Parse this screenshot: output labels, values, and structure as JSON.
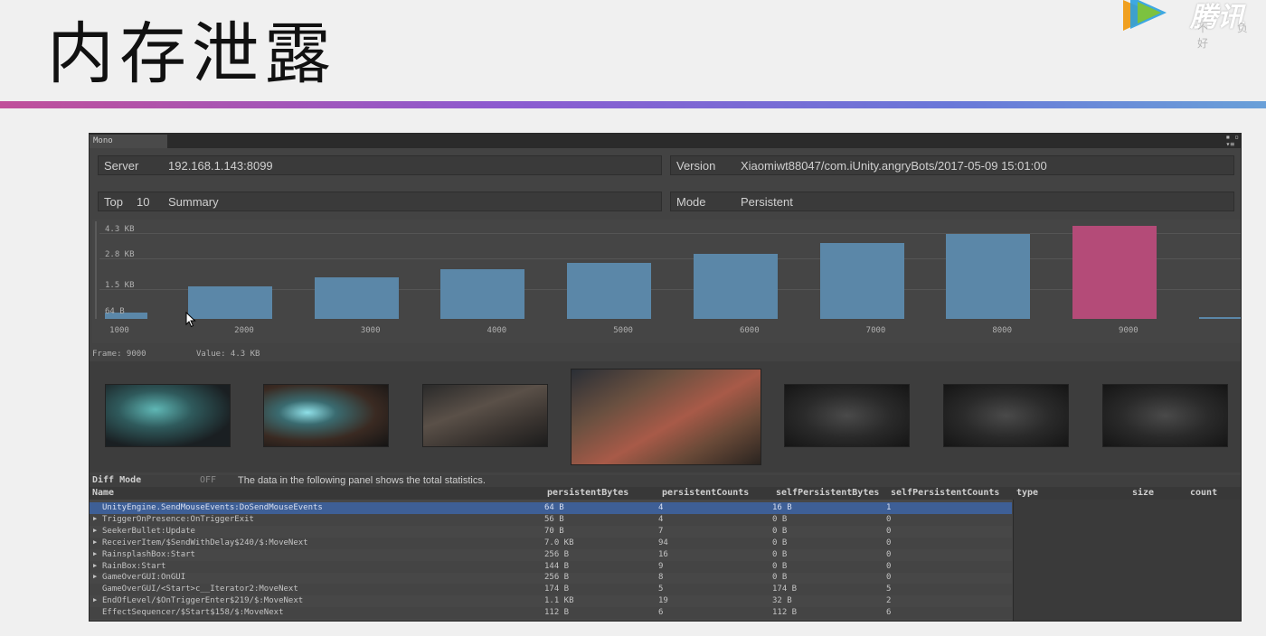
{
  "slide": {
    "title": "内存泄露"
  },
  "logo": {
    "text": "腾讯",
    "sub": "不 负 好"
  },
  "panel": {
    "tab": "Mono",
    "server_label": "Server",
    "server_value": "192.168.1.143:8099",
    "version_label": "Version",
    "version_value": "Xiaomiwt88047/com.iUnity.angryBots/2017-05-09 15:01:00",
    "top_label": "Top",
    "top_value": "10",
    "summary_label": "Summary",
    "mode_label": "Mode",
    "mode_value": "Persistent"
  },
  "chart_data": {
    "type": "bar",
    "yticks": [
      "4.3 KB",
      "2.8 KB",
      "1.5 KB",
      "64 B"
    ],
    "xticks": [
      "1000",
      "2000",
      "3000",
      "4000",
      "5000",
      "6000",
      "7000",
      "8000",
      "9000"
    ],
    "bars": [
      {
        "frame": 1000,
        "value_kb": 0.3,
        "highlight": false
      },
      {
        "frame": 2000,
        "value_kb": 1.5,
        "highlight": false
      },
      {
        "frame": 3000,
        "value_kb": 1.9,
        "highlight": false
      },
      {
        "frame": 4000,
        "value_kb": 2.3,
        "highlight": false
      },
      {
        "frame": 5000,
        "value_kb": 2.6,
        "highlight": false
      },
      {
        "frame": 6000,
        "value_kb": 3.0,
        "highlight": false
      },
      {
        "frame": 7000,
        "value_kb": 3.5,
        "highlight": false
      },
      {
        "frame": 8000,
        "value_kb": 3.9,
        "highlight": false
      },
      {
        "frame": 9000,
        "value_kb": 4.3,
        "highlight": true
      },
      {
        "frame": 10000,
        "value_kb": 0.02,
        "highlight": false
      }
    ],
    "colors": {
      "bar": "#5b87a8",
      "highlight": "#b44b78"
    }
  },
  "frame_info": {
    "frame": "Frame: 9000",
    "value": "Value: 4.3 KB"
  },
  "diff": {
    "label": "Diff Mode",
    "state": "OFF",
    "note": "The data in the following panel shows the total statistics."
  },
  "table": {
    "headers": [
      "Name",
      "persistentBytes",
      "persistentCounts",
      "selfPersistentBytes",
      "selfPersistentCounts"
    ],
    "side_headers": [
      "type",
      "size",
      "count"
    ],
    "rows": [
      {
        "name": "UnityEngine.SendMouseEvents:DoSendMouseEvents",
        "pb": "64 B",
        "pc": "4",
        "spb": "16 B",
        "spc": "1",
        "expand": ""
      },
      {
        "name": "TriggerOnPresence:OnTriggerExit",
        "pb": "56 B",
        "pc": "4",
        "spb": "0 B",
        "spc": "0",
        "expand": "▶"
      },
      {
        "name": "SeekerBullet:Update",
        "pb": "70 B",
        "pc": "7",
        "spb": "0 B",
        "spc": "0",
        "expand": "▶"
      },
      {
        "name": "ReceiverItem/$SendWithDelay$240/$:MoveNext",
        "pb": "7.0 KB",
        "pc": "94",
        "spb": "0 B",
        "spc": "0",
        "expand": "▶"
      },
      {
        "name": "RainsplashBox:Start",
        "pb": "256 B",
        "pc": "16",
        "spb": "0 B",
        "spc": "0",
        "expand": "▶"
      },
      {
        "name": "RainBox:Start",
        "pb": "144 B",
        "pc": "9",
        "spb": "0 B",
        "spc": "0",
        "expand": "▶"
      },
      {
        "name": "GameOverGUI:OnGUI",
        "pb": "256 B",
        "pc": "8",
        "spb": "0 B",
        "spc": "0",
        "expand": "▶"
      },
      {
        "name": "GameOverGUI/<Start>c__Iterator2:MoveNext",
        "pb": "174 B",
        "pc": "5",
        "spb": "174 B",
        "spc": "5",
        "expand": ""
      },
      {
        "name": "EndOfLevel/$OnTriggerEnter$219/$:MoveNext",
        "pb": "1.1 KB",
        "pc": "19",
        "spb": "32 B",
        "spc": "2",
        "expand": "▶"
      },
      {
        "name": "EffectSequencer/$Start$158/$:MoveNext",
        "pb": "112 B",
        "pc": "6",
        "spb": "112 B",
        "spc": "6",
        "expand": ""
      }
    ]
  }
}
